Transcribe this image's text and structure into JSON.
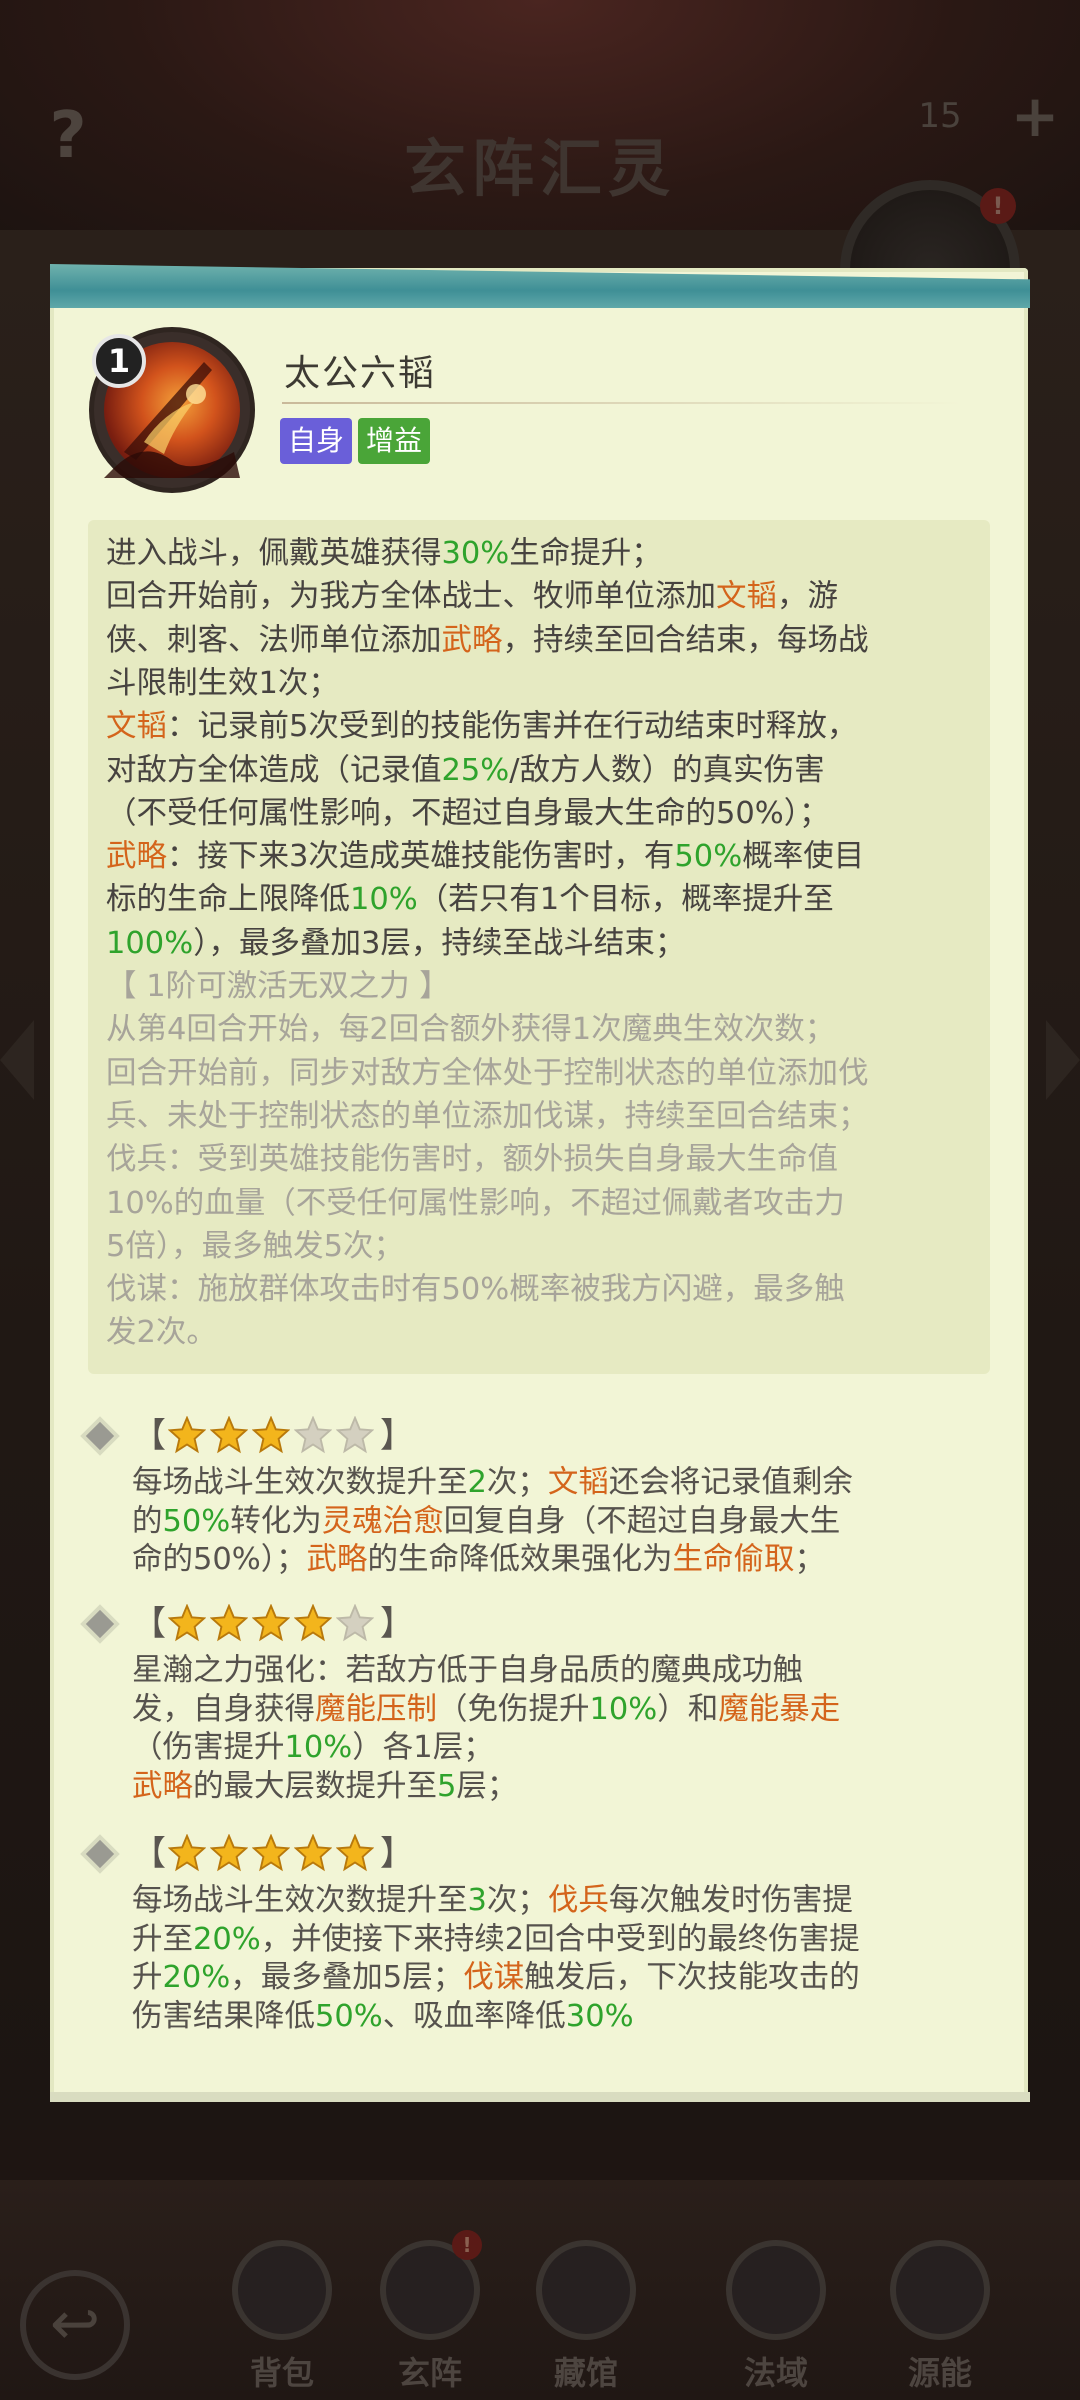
{
  "background": {
    "help_icon": "?",
    "title": "玄阵汇灵",
    "counter": "15",
    "plus_icon": "+",
    "alert_mark": "!"
  },
  "skill": {
    "level": "1",
    "title": "太公六韬",
    "tags": [
      "自身",
      "增益"
    ]
  },
  "description": [
    [
      {
        "t": "进入战斗，佩戴英雄获得",
        "c": "n"
      },
      {
        "t": "30%",
        "c": "g"
      },
      {
        "t": "生命提升；",
        "c": "n"
      }
    ],
    [
      {
        "t": "回合开始前，为我方全体战士、牧师单位添加",
        "c": "n"
      },
      {
        "t": "文韬",
        "c": "o"
      },
      {
        "t": "，游",
        "c": "n"
      }
    ],
    [
      {
        "t": "侠、刺客、法师单位添加",
        "c": "n"
      },
      {
        "t": "武略",
        "c": "o"
      },
      {
        "t": "，持续至回合结束，每场战",
        "c": "n"
      }
    ],
    [
      {
        "t": "斗限制生效1次；",
        "c": "n"
      }
    ],
    [
      {
        "t": "文韬",
        "c": "o"
      },
      {
        "t": "：记录前5次受到的技能伤害并在行动结束时释放，",
        "c": "n"
      }
    ],
    [
      {
        "t": "对敌方全体造成（记录值",
        "c": "n"
      },
      {
        "t": "25%",
        "c": "g"
      },
      {
        "t": "/敌方人数）的真实伤害",
        "c": "n"
      }
    ],
    [
      {
        "t": "（不受任何属性影响，不超过自身最大生命的50%）；",
        "c": "n"
      }
    ],
    [
      {
        "t": "武略",
        "c": "o"
      },
      {
        "t": "：接下来3次造成英雄技能伤害时，有",
        "c": "n"
      },
      {
        "t": "50%",
        "c": "g"
      },
      {
        "t": "概率使目",
        "c": "n"
      }
    ],
    [
      {
        "t": "标的生命上限降低",
        "c": "n"
      },
      {
        "t": "10%",
        "c": "g"
      },
      {
        "t": "（若只有1个目标，概率提升至",
        "c": "n"
      }
    ],
    [
      {
        "t": "100%",
        "c": "g"
      },
      {
        "t": "），最多叠加3层，持续至战斗结束；",
        "c": "n"
      }
    ],
    [
      {
        "t": "【 1阶可激活无双之力 】",
        "c": "m"
      }
    ],
    [
      {
        "t": "从第4回合开始，每2回合额外获得1次魔典生效次数；",
        "c": "m"
      }
    ],
    [
      {
        "t": "回合开始前，同步对敌方全体处于控制状态的单位添加伐",
        "c": "m"
      }
    ],
    [
      {
        "t": "兵、未处于控制状态的单位添加伐谋，持续至回合结束；",
        "c": "m"
      }
    ],
    [
      {
        "t": "伐兵：受到英雄技能伤害时，额外损失自身最大生命值",
        "c": "m"
      }
    ],
    [
      {
        "t": "10%的血量（不受任何属性影响，不超过佩戴者攻击力",
        "c": "m"
      }
    ],
    [
      {
        "t": "5倍），最多触发5次；",
        "c": "m"
      }
    ],
    [
      {
        "t": "伐谋：施放群体攻击时有50%概率被我方闪避，最多触",
        "c": "m"
      }
    ],
    [
      {
        "t": "发2次。",
        "c": "m"
      }
    ]
  ],
  "star_levels": [
    {
      "filled": 3,
      "total": 5,
      "lines": [
        [
          {
            "t": "每场战斗生效次数提升至",
            "c": "n"
          },
          {
            "t": "2",
            "c": "g"
          },
          {
            "t": "次；",
            "c": "n"
          },
          {
            "t": "文韬",
            "c": "o"
          },
          {
            "t": "还会将记录值剩余",
            "c": "n"
          }
        ],
        [
          {
            "t": "的",
            "c": "n"
          },
          {
            "t": "50%",
            "c": "g"
          },
          {
            "t": "转化为",
            "c": "n"
          },
          {
            "t": "灵魂治愈",
            "c": "o"
          },
          {
            "t": "回复自身（不超过自身最大生",
            "c": "n"
          }
        ],
        [
          {
            "t": "命的50%）；",
            "c": "n"
          },
          {
            "t": "武略",
            "c": "o"
          },
          {
            "t": "的生命降低效果强化为",
            "c": "n"
          },
          {
            "t": "生命偷取",
            "c": "o"
          },
          {
            "t": "；",
            "c": "n"
          }
        ]
      ]
    },
    {
      "filled": 4,
      "total": 5,
      "lines": [
        [
          {
            "t": "星瀚之力强化：若敌方低于自身品质的魔典成功触",
            "c": "n"
          }
        ],
        [
          {
            "t": "发，自身获得",
            "c": "n"
          },
          {
            "t": "魔能压制",
            "c": "o"
          },
          {
            "t": "（免伤提升",
            "c": "n"
          },
          {
            "t": "10%",
            "c": "g"
          },
          {
            "t": "）和",
            "c": "n"
          },
          {
            "t": "魔能暴走",
            "c": "o"
          }
        ],
        [
          {
            "t": "（伤害提升",
            "c": "n"
          },
          {
            "t": "10%",
            "c": "g"
          },
          {
            "t": "）各1层；",
            "c": "n"
          }
        ],
        [
          {
            "t": "武略",
            "c": "o"
          },
          {
            "t": "的最大层数提升至",
            "c": "n"
          },
          {
            "t": "5",
            "c": "g"
          },
          {
            "t": "层；",
            "c": "n"
          }
        ]
      ]
    },
    {
      "filled": 5,
      "total": 5,
      "lines": [
        [
          {
            "t": "每场战斗生效次数提升至",
            "c": "n"
          },
          {
            "t": "3",
            "c": "g"
          },
          {
            "t": "次；",
            "c": "n"
          },
          {
            "t": "伐兵",
            "c": "o"
          },
          {
            "t": "每次触发时伤害提",
            "c": "n"
          }
        ],
        [
          {
            "t": "升至",
            "c": "n"
          },
          {
            "t": "20%",
            "c": "g"
          },
          {
            "t": "，并使接下来持续2回合中受到的最终伤害提",
            "c": "n"
          }
        ],
        [
          {
            "t": "升",
            "c": "n"
          },
          {
            "t": "20%",
            "c": "g"
          },
          {
            "t": "，最多叠加5层；",
            "c": "n"
          },
          {
            "t": "伐谋",
            "c": "o"
          },
          {
            "t": "触发后，下次技能攻击的",
            "c": "n"
          }
        ],
        [
          {
            "t": "伤害结果降低",
            "c": "n"
          },
          {
            "t": "50%",
            "c": "g"
          },
          {
            "t": "、吸血率降低",
            "c": "n"
          },
          {
            "t": "30%",
            "c": "g"
          }
        ]
      ]
    }
  ],
  "bottom_nav": {
    "back_icon": "back-arrow-icon",
    "items": [
      {
        "label": "背包",
        "icon": "backpack-emblem-icon",
        "alert": false
      },
      {
        "label": "玄阵",
        "icon": "formation-emblem-icon",
        "alert": true
      },
      {
        "label": "藏馆",
        "icon": "collection-book-icon",
        "alert": false
      },
      {
        "label": "法域",
        "icon": "domain-swirl-icon",
        "alert": false
      },
      {
        "label": "源能",
        "icon": "source-energy-icon",
        "alert": false
      }
    ]
  },
  "colors": {
    "card_bg": "#f2f5d6",
    "desc_bg": "#e6eac2",
    "green_value": "#2fa32c",
    "orange_keyword": "#d4641b",
    "muted_text": "#a7a49a",
    "tag_self": "#6a5fd9",
    "tag_buff": "#4aa538",
    "star_gold": "#f3b51c",
    "star_empty": "#d4d0c0"
  }
}
